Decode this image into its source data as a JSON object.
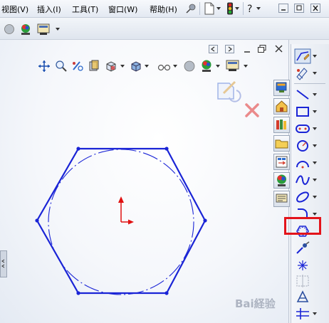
{
  "menu": {
    "items": [
      "视图(V)",
      "插入(I)",
      "工具(T)",
      "窗口(W)",
      "帮助(H)"
    ]
  },
  "title_controls": [
    "minimize",
    "restore",
    "close"
  ],
  "view_toolbar": {
    "icons": [
      "move-icon",
      "zoom-icon",
      "rotate-icon",
      "section-view-icon",
      "view-orientation-icon",
      "display-style-icon",
      "hide-show-icon",
      "edit-appearance-icon",
      "scene-icon",
      "view-settings-icon"
    ]
  },
  "taskpane": {
    "buttons": [
      "sw-resources-icon",
      "home-icon",
      "design-library-icon",
      "file-explorer-icon",
      "view-palette-icon",
      "appearances-icon",
      "custom-properties-icon"
    ]
  },
  "sketch_toolbar": {
    "tools": [
      "sketch-icon",
      "smart-dimension-icon",
      "line-icon",
      "rectangle-icon",
      "slot-icon",
      "circle-icon",
      "arc-icon",
      "spline-icon",
      "ellipse-icon",
      "fillet-icon",
      "polygon-icon",
      "trim-icon",
      "point-icon",
      "mirror-icon",
      "text-icon",
      "pattern-icon"
    ],
    "highlighted_tool": "polygon-icon"
  },
  "sketch": {
    "shape": "hexagon",
    "inscribed_circle": "construction"
  },
  "watermark": "Bai経验",
  "colors": {
    "sketch_blue": "#1a24d6",
    "origin_red": "#e01010",
    "highlight_red": "#e3141b"
  }
}
